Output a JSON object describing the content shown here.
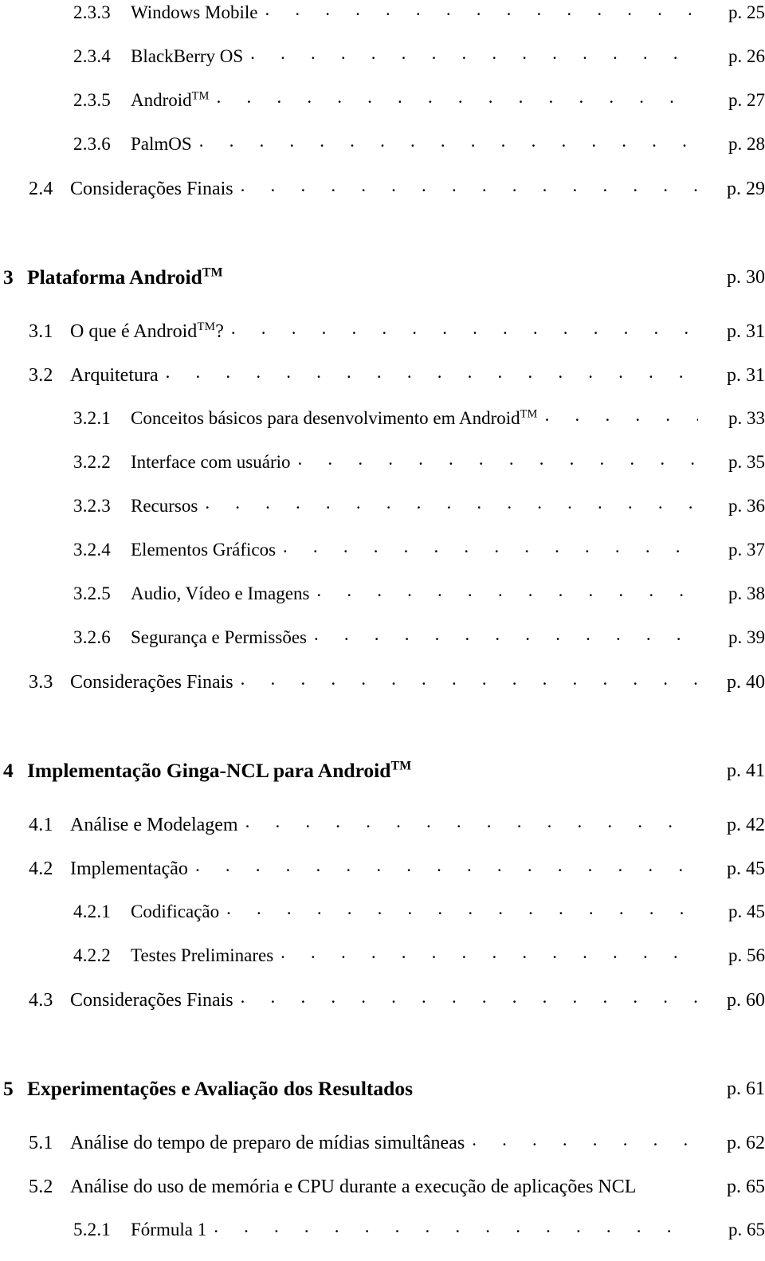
{
  "document": {
    "type": "table-of-contents",
    "language": "pt-BR",
    "page_prefix": "p."
  },
  "entries": [
    {
      "level": "subsubsection",
      "number": "2.3.3",
      "title": "Windows Mobile",
      "tm": false,
      "page": "p. 25",
      "leader": true
    },
    {
      "level": "subsubsection",
      "number": "2.3.4",
      "title": "BlackBerry OS",
      "tm": false,
      "page": "p. 26",
      "leader": true
    },
    {
      "level": "subsubsection",
      "number": "2.3.5",
      "title": "Android",
      "tm": true,
      "page": "p. 27",
      "leader": true
    },
    {
      "level": "subsubsection",
      "number": "2.3.6",
      "title": "PalmOS",
      "tm": false,
      "page": "p. 28",
      "leader": true
    },
    {
      "level": "section",
      "number": "2.4",
      "title": "Considerações Finais",
      "tm": false,
      "page": "p. 29",
      "leader": true
    },
    {
      "level": "chapter",
      "number": "3",
      "title": "Plataforma Android",
      "tm": true,
      "page": "p. 30",
      "leader": false
    },
    {
      "level": "section",
      "number": "3.1",
      "title": "O que é Android",
      "tm": true,
      "title_suffix": "?",
      "page": "p. 31",
      "leader": true
    },
    {
      "level": "section",
      "number": "3.2",
      "title": "Arquitetura",
      "tm": false,
      "page": "p. 31",
      "leader": true
    },
    {
      "level": "subsubsection",
      "number": "3.2.1",
      "title": "Conceitos básicos para desenvolvimento em Android",
      "tm": true,
      "page": "p. 33",
      "leader": true
    },
    {
      "level": "subsubsection",
      "number": "3.2.2",
      "title": "Interface com usuário",
      "tm": false,
      "page": "p. 35",
      "leader": true
    },
    {
      "level": "subsubsection",
      "number": "3.2.3",
      "title": "Recursos",
      "tm": false,
      "page": "p. 36",
      "leader": true
    },
    {
      "level": "subsubsection",
      "number": "3.2.4",
      "title": "Elementos Gráficos",
      "tm": false,
      "page": "p. 37",
      "leader": true
    },
    {
      "level": "subsubsection",
      "number": "3.2.5",
      "title": "Audio, Vídeo e Imagens",
      "tm": false,
      "page": "p. 38",
      "leader": true
    },
    {
      "level": "subsubsection",
      "number": "3.2.6",
      "title": "Segurança e Permissões",
      "tm": false,
      "page": "p. 39",
      "leader": true
    },
    {
      "level": "section",
      "number": "3.3",
      "title": "Considerações Finais",
      "tm": false,
      "page": "p. 40",
      "leader": true
    },
    {
      "level": "chapter",
      "number": "4",
      "title": "Implementação Ginga-NCL para Android",
      "tm": true,
      "page": "p. 41",
      "leader": false
    },
    {
      "level": "section",
      "number": "4.1",
      "title": "Análise e Modelagem",
      "tm": false,
      "page": "p. 42",
      "leader": true
    },
    {
      "level": "section",
      "number": "4.2",
      "title": "Implementação",
      "tm": false,
      "page": "p. 45",
      "leader": true
    },
    {
      "level": "subsubsection",
      "number": "4.2.1",
      "title": "Codificação",
      "tm": false,
      "page": "p. 45",
      "leader": true
    },
    {
      "level": "subsubsection",
      "number": "4.2.2",
      "title": "Testes Preliminares",
      "tm": false,
      "page": "p. 56",
      "leader": true
    },
    {
      "level": "section",
      "number": "4.3",
      "title": "Considerações Finais",
      "tm": false,
      "page": "p. 60",
      "leader": true
    },
    {
      "level": "chapter",
      "number": "5",
      "title": "Experimentações e Avaliação dos Resultados",
      "tm": false,
      "page": "p. 61",
      "leader": false
    },
    {
      "level": "section",
      "number": "5.1",
      "title": "Análise do tempo de preparo de mídias simultâneas",
      "tm": false,
      "page": "p. 62",
      "leader": true
    },
    {
      "level": "section",
      "number": "5.2",
      "title": "Análise do uso de memória e CPU durante a execução de aplicações NCL",
      "tm": false,
      "page": "p. 65",
      "leader": false
    },
    {
      "level": "subsubsection",
      "number": "5.2.1",
      "title": "Fórmula 1",
      "tm": false,
      "page": "p. 65",
      "leader": true
    }
  ]
}
